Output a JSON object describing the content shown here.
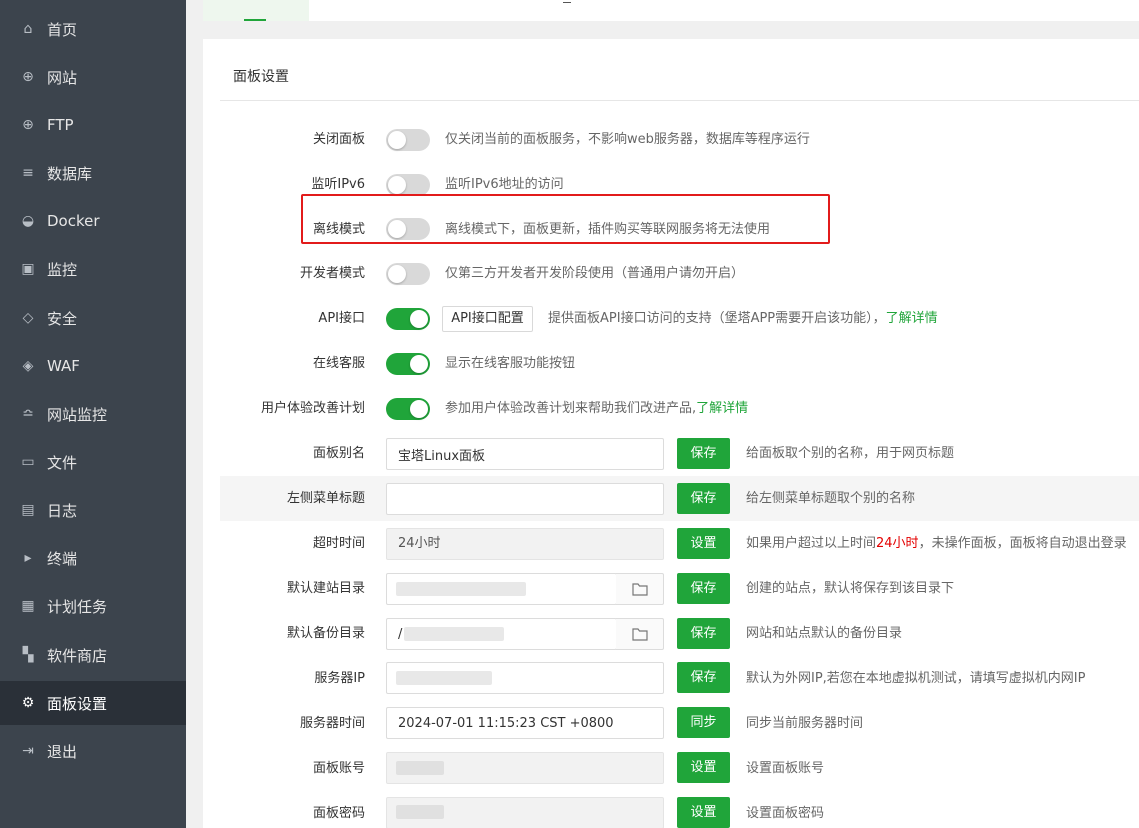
{
  "sidebar": {
    "items": [
      {
        "label": "首页",
        "icon": "home-icon",
        "glyph": "⌂"
      },
      {
        "label": "网站",
        "icon": "globe-icon",
        "glyph": "⊕"
      },
      {
        "label": "FTP",
        "icon": "ftp-globe-icon",
        "glyph": "⊕"
      },
      {
        "label": "数据库",
        "icon": "database-icon",
        "glyph": "≡"
      },
      {
        "label": "Docker",
        "icon": "docker-icon",
        "glyph": "◒"
      },
      {
        "label": "监控",
        "icon": "monitor-chart-icon",
        "glyph": "▣"
      },
      {
        "label": "安全",
        "icon": "shield-icon",
        "glyph": "◇"
      },
      {
        "label": "WAF",
        "icon": "waf-shield-icon",
        "glyph": "◈"
      },
      {
        "label": "网站监控",
        "icon": "site-monitor-icon",
        "glyph": "≏"
      },
      {
        "label": "文件",
        "icon": "folder-icon",
        "glyph": "▭"
      },
      {
        "label": "日志",
        "icon": "log-icon",
        "glyph": "▤"
      },
      {
        "label": "终端",
        "icon": "terminal-icon",
        "glyph": "▸"
      },
      {
        "label": "计划任务",
        "icon": "calendar-icon",
        "glyph": "▦"
      },
      {
        "label": "软件商店",
        "icon": "app-store-icon",
        "glyph": "▚"
      },
      {
        "label": "面板设置",
        "icon": "gear-icon",
        "glyph": "⚙"
      },
      {
        "label": "退出",
        "icon": "logout-icon",
        "glyph": "⇥"
      }
    ],
    "active_index": 14
  },
  "panel": {
    "title": "面板设置",
    "toggles": [
      {
        "label": "关闭面板",
        "on": false,
        "desc": "仅关闭当前的面板服务，不影响web服务器，数据库等程序运行"
      },
      {
        "label": "监听IPv6",
        "on": false,
        "desc": "监听IPv6地址的访问"
      },
      {
        "label": "离线模式",
        "on": false,
        "desc": "离线模式下，面板更新，插件购买等联网服务将无法使用"
      },
      {
        "label": "开发者模式",
        "on": false,
        "desc": "仅第三方开发者开发阶段使用（普通用户请勿开启）"
      },
      {
        "label": "API接口",
        "on": true,
        "button": "API接口配置",
        "desc": "提供面板API接口访问的支持（堡塔APP需要开启该功能），",
        "link": "了解详情"
      },
      {
        "label": "在线客服",
        "on": true,
        "desc": "显示在线客服功能按钮"
      },
      {
        "label": "用户体验改善计划",
        "on": true,
        "desc": "参加用户体验改善计划来帮助我们改进产品,",
        "link": "了解详情"
      }
    ],
    "fields": [
      {
        "label": "面板别名",
        "value": "宝塔Linux面板",
        "button": "保存",
        "desc": "给面板取个别的名称，用于网页标题"
      },
      {
        "label": "左侧菜单标题",
        "value": "",
        "button": "保存",
        "desc": "给左侧菜单标题取个别的名称"
      },
      {
        "label": "超时时间",
        "value": "24小时",
        "button": "设置",
        "desc_before": "如果用户超过以上时间",
        "desc_red": "24小时",
        "desc_after": "，未操作面板，面板将自动退出登录"
      },
      {
        "label": "默认建站目录",
        "value": "",
        "button": "保存",
        "desc": "创建的站点，默认将保存到该目录下"
      },
      {
        "label": "默认备份目录",
        "value": "/",
        "button": "保存",
        "desc": "网站和站点默认的备份目录"
      },
      {
        "label": "服务器IP",
        "value": "",
        "button": "保存",
        "desc": "默认为外网IP,若您在本地虚拟机测试，请填写虚拟机内网IP"
      },
      {
        "label": "服务器时间",
        "value": "2024-07-01 11:15:23 CST +0800",
        "button": "同步",
        "desc": "同步当前服务器时间"
      },
      {
        "label": "面板账号",
        "value": "",
        "button": "设置",
        "desc": "设置面板账号"
      },
      {
        "label": "面板密码",
        "value": "",
        "button": "设置",
        "desc": "设置面板密码"
      }
    ]
  },
  "colors": {
    "accent": "#20a53a",
    "sidebar": "#3c444d",
    "highlight": "#e21b1b"
  }
}
